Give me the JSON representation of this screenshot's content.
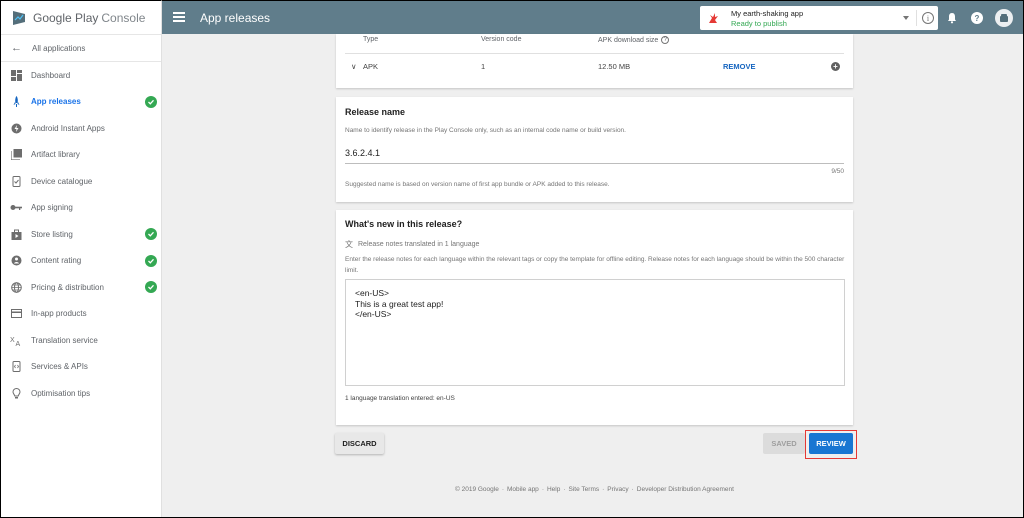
{
  "brand": {
    "name_part1": "Google Play",
    "name_part2": "Console"
  },
  "sidebar": {
    "back_label": "All applications",
    "items": [
      {
        "label": "Dashboard",
        "icon": "dashboard-icon",
        "active": false,
        "checked": false
      },
      {
        "label": "App releases",
        "icon": "rocket-icon",
        "active": true,
        "checked": true
      },
      {
        "label": "Android Instant Apps",
        "icon": "instant-apps-icon",
        "active": false,
        "checked": false
      },
      {
        "label": "Artifact library",
        "icon": "library-icon",
        "active": false,
        "checked": false
      },
      {
        "label": "Device catalogue",
        "icon": "device-check-icon",
        "active": false,
        "checked": false
      },
      {
        "label": "App signing",
        "icon": "key-icon",
        "active": false,
        "checked": false
      },
      {
        "label": "Store listing",
        "icon": "store-icon",
        "active": false,
        "checked": true
      },
      {
        "label": "Content rating",
        "icon": "content-rating-icon",
        "active": false,
        "checked": true
      },
      {
        "label": "Pricing & distribution",
        "icon": "globe-icon",
        "active": false,
        "checked": true
      },
      {
        "label": "In-app products",
        "icon": "credit-card-icon",
        "active": false,
        "checked": false
      },
      {
        "label": "Translation service",
        "icon": "translate-icon",
        "active": false,
        "checked": false
      },
      {
        "label": "Services & APIs",
        "icon": "api-icon",
        "active": false,
        "checked": false
      },
      {
        "label": "Optimisation tips",
        "icon": "lightbulb-icon",
        "active": false,
        "checked": false
      }
    ]
  },
  "topbar": {
    "title": "App releases",
    "app_name": "My earth-shaking app",
    "app_status": "Ready to publish",
    "info_glyph": "i"
  },
  "artifacts": {
    "headers": {
      "type": "Type",
      "version_code": "Version code",
      "download_size": "APK download size"
    },
    "rows": [
      {
        "type": "APK",
        "version_code": "1",
        "download_size": "12.50 MB",
        "action": "REMOVE"
      }
    ]
  },
  "release_name": {
    "title": "Release name",
    "hint": "Name to identify release in the Play Console only, such as an internal code name or build version.",
    "value": "3.6.2.4.1",
    "counter": "9/50",
    "suggestion": "Suggested name is based on version name of first app bundle or APK added to this release."
  },
  "whats_new": {
    "title": "What's new in this release?",
    "translated": "Release notes translated in 1 language",
    "description": "Enter the release notes for each language within the relevant tags or copy the template for offline editing. Release notes for each language should be within the 500 character limit.",
    "notes": "<en-US>\nThis is a great test app!\n</en-US>",
    "languages_entered": "1 language translation entered: en-US"
  },
  "actions": {
    "discard": "DISCARD",
    "saved": "SAVED",
    "review": "REVIEW"
  },
  "footer": {
    "links": [
      "© 2019 Google",
      "Mobile app",
      "Help",
      "Site Terms",
      "Privacy",
      "Developer Distribution Agreement"
    ]
  },
  "colors": {
    "topbar": "#607d8b",
    "accent": "#1976d2",
    "success": "#34a853",
    "highlight": "#e53935"
  }
}
